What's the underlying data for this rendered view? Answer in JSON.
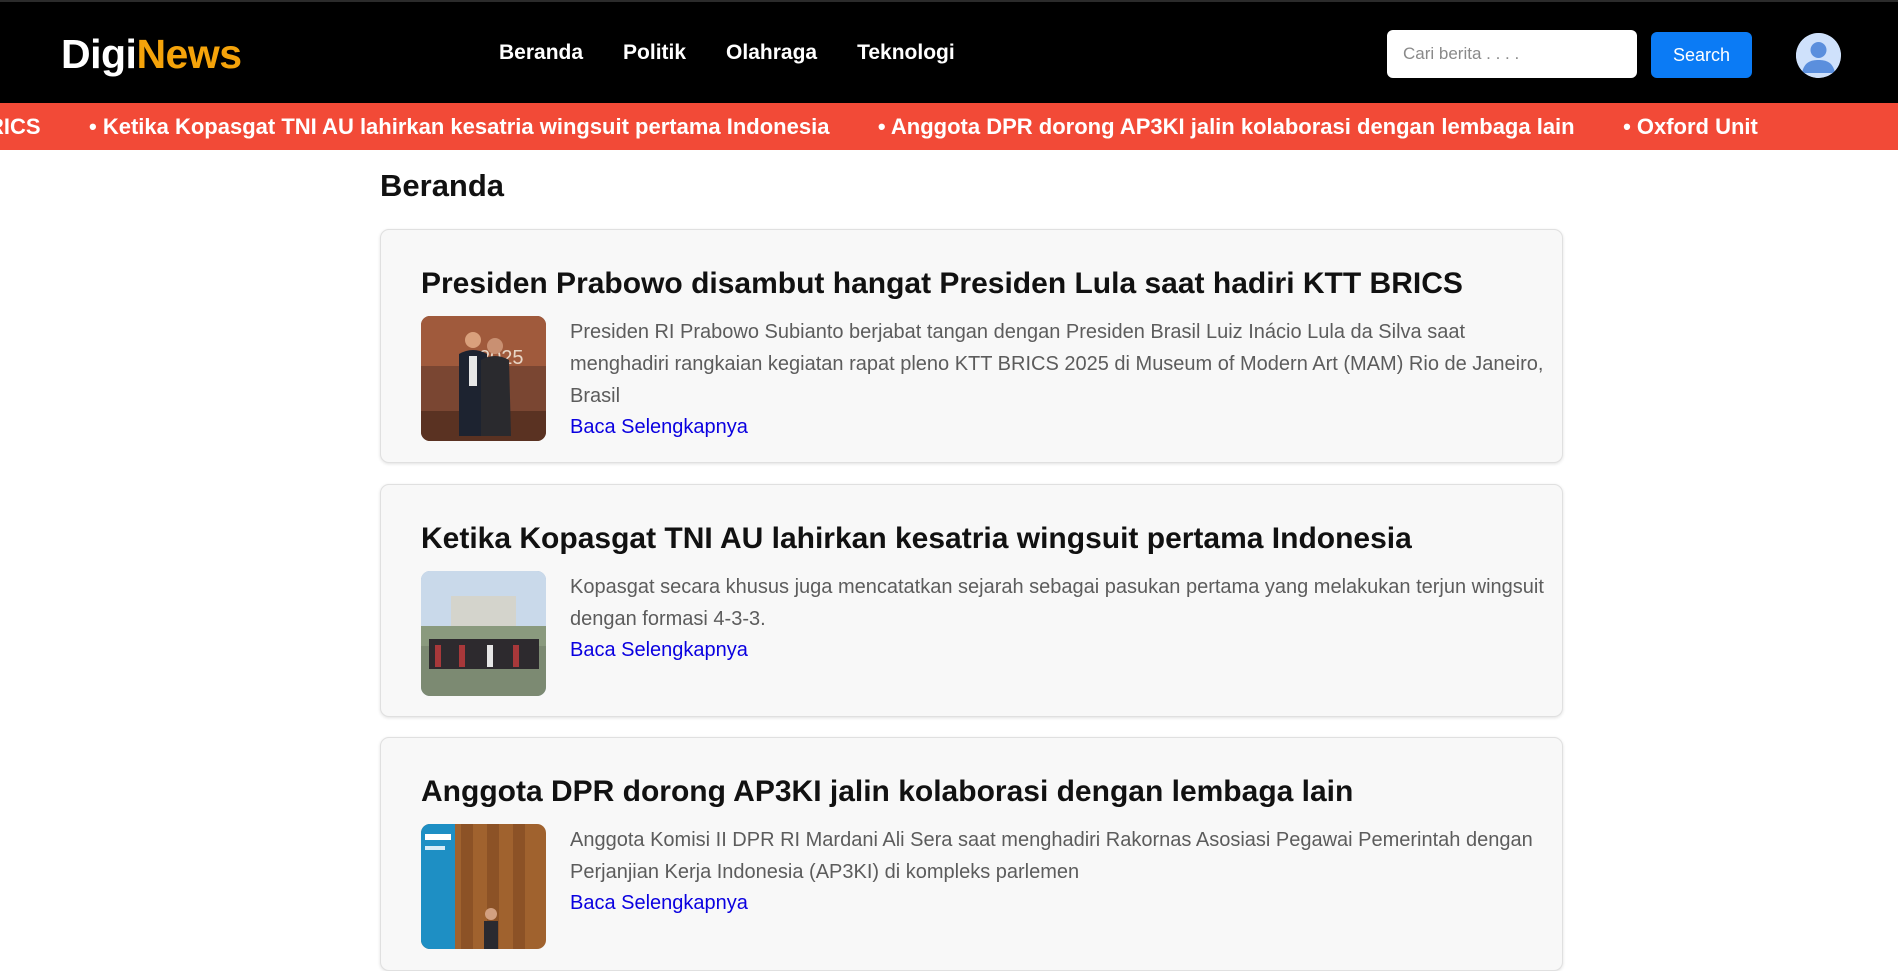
{
  "brand": {
    "part1": "Digi",
    "part2": "News"
  },
  "nav": {
    "items": [
      "Beranda",
      "Politik",
      "Olahraga",
      "Teknologi"
    ]
  },
  "search": {
    "placeholder": "Cari berita . . . .",
    "button": "Search"
  },
  "ticker": {
    "items": [
      "RICS",
      "• Ketika Kopasgat TNI AU lahirkan kesatria wingsuit pertama Indonesia",
      "• Anggota DPR dorong AP3KI jalin kolaborasi dengan lembaga lain",
      "• Oxford Unit"
    ]
  },
  "page": {
    "title": "Beranda"
  },
  "articles": [
    {
      "title": "Presiden Prabowo disambut hangat Presiden Lula saat hadiri KTT BRICS",
      "excerpt": "Presiden RI Prabowo Subianto berjabat tangan dengan Presiden Brasil Luiz Inácio Lula da Silva saat menghadiri rangkaian kegiatan rapat pleno KTT BRICS 2025 di Museum of Modern Art (MAM) Rio de Janeiro, Brasil",
      "read_more": "Baca Selengkapnya"
    },
    {
      "title": "Ketika Kopasgat TNI AU lahirkan kesatria wingsuit pertama Indonesia",
      "excerpt": "Kopasgat secara khusus juga mencatatkan sejarah sebagai pasukan pertama yang melakukan terjun wingsuit dengan formasi 4-3-3.",
      "read_more": "Baca Selengkapnya"
    },
    {
      "title": "Anggota DPR dorong AP3KI jalin kolaborasi dengan lembaga lain",
      "excerpt": "Anggota Komisi II DPR RI Mardani Ali Sera saat menghadiri Rakornas Asosiasi Pegawai Pemerintah dengan Perjanjian Kerja Indonesia (AP3KI) di kompleks parlemen",
      "read_more": "Baca Selengkapnya"
    }
  ],
  "colors": {
    "header_bg": "#000000",
    "brand_accent": "#f5a30a",
    "ticker_bg": "#f24a37",
    "button_bg": "#0b7bf5",
    "link": "#0a00e0"
  },
  "icons": {
    "avatar": "user-avatar-icon"
  }
}
